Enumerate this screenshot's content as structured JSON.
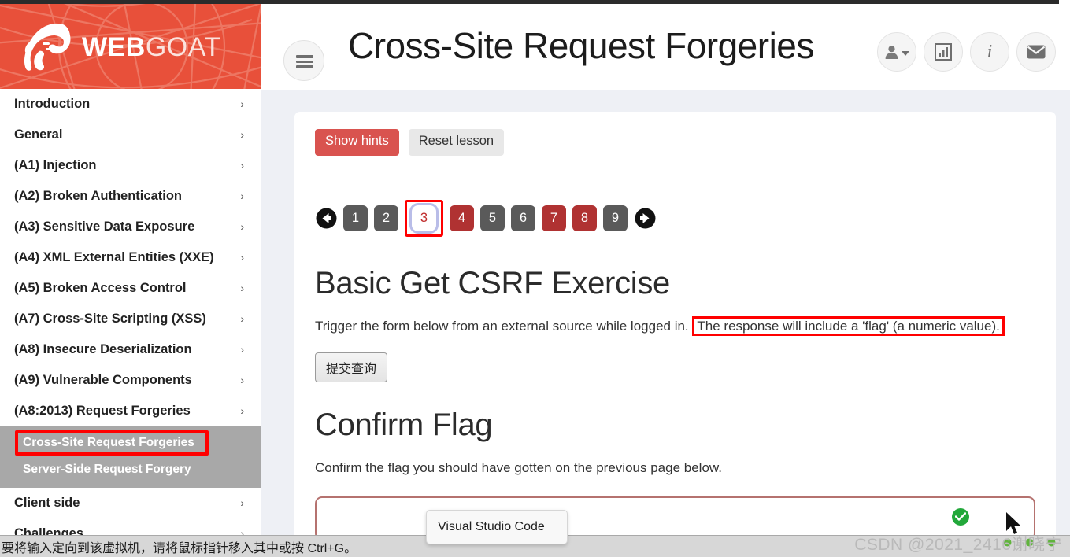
{
  "brand": {
    "name_bold": "WEB",
    "name_light": "GOAT",
    "logo_icon": "goat-head-icon",
    "background_icon": "spider-web-pattern"
  },
  "sidebar": {
    "items": [
      {
        "label": "Introduction",
        "chevron": "›"
      },
      {
        "label": "General",
        "chevron": "›"
      },
      {
        "label": "(A1) Injection",
        "chevron": "›"
      },
      {
        "label": "(A2) Broken Authentication",
        "chevron": "›"
      },
      {
        "label": "(A3) Sensitive Data Exposure",
        "chevron": "›"
      },
      {
        "label": "(A4) XML External Entities (XXE)",
        "chevron": "›"
      },
      {
        "label": "(A5) Broken Access Control",
        "chevron": "›"
      },
      {
        "label": "(A7) Cross-Site Scripting (XSS)",
        "chevron": "›"
      },
      {
        "label": "(A8) Insecure Deserialization",
        "chevron": "›"
      },
      {
        "label": "(A9) Vulnerable Components",
        "chevron": "›"
      },
      {
        "label": "(A8:2013) Request Forgeries",
        "chevron": "›"
      }
    ],
    "submenu": [
      {
        "label": "Cross-Site Request Forgeries",
        "annotated": true
      },
      {
        "label": "Server-Side Request Forgery",
        "annotated": false
      }
    ],
    "items_after": [
      {
        "label": "Client side",
        "chevron": "›"
      },
      {
        "label": "Challenges",
        "chevron": "›"
      }
    ]
  },
  "header": {
    "title": "Cross-Site Request Forgeries",
    "menu_icon": "hamburger-menu-icon",
    "icons": [
      {
        "name": "user-account-icon",
        "has_caret": true
      },
      {
        "name": "bar-chart-icon",
        "has_caret": false
      },
      {
        "name": "info-icon",
        "glyph": "i",
        "has_caret": false
      },
      {
        "name": "envelope-icon",
        "has_caret": false
      }
    ]
  },
  "toolbar": {
    "show_hints_label": "Show hints",
    "reset_lesson_label": "Reset lesson"
  },
  "pagination": {
    "prev_icon": "arrow-left-circle-icon",
    "next_icon": "arrow-right-circle-icon",
    "pages": [
      {
        "label": "1",
        "state": "grey"
      },
      {
        "label": "2",
        "state": "grey"
      },
      {
        "label": "3",
        "state": "active"
      },
      {
        "label": "4",
        "state": "red"
      },
      {
        "label": "5",
        "state": "grey"
      },
      {
        "label": "6",
        "state": "grey"
      },
      {
        "label": "7",
        "state": "red"
      },
      {
        "label": "8",
        "state": "red"
      },
      {
        "label": "9",
        "state": "grey"
      }
    ]
  },
  "lesson": {
    "heading": "Basic Get CSRF Exercise",
    "paragraph_plain": "Trigger the form below from an external source while logged in.",
    "paragraph_highlighted": "The response will include a 'flag' (a numeric value).",
    "submit_button_label": "提交查询"
  },
  "confirm": {
    "heading": "Confirm Flag",
    "description": "Confirm the flag you should have gotten on the previous page below.",
    "input_value": "",
    "status_icon": "green-check-circle-icon"
  },
  "tooltip": {
    "text": "Visual Studio Code"
  },
  "statusbar": {
    "text": "要将输入定向到该虚拟机，请将鼠标指针移入其中或按 Ctrl+G。"
  },
  "watermark": {
    "text": "CSDN @2021_2416谢晓宁"
  },
  "colors": {
    "brand_red": "#e8503a",
    "hint_red": "#d9534f",
    "page_red": "#b03232",
    "page_grey": "#5a5a5a",
    "annotation_red": "#ff0000",
    "success_green": "#22a83a",
    "page_bg": "#eef0f5"
  }
}
